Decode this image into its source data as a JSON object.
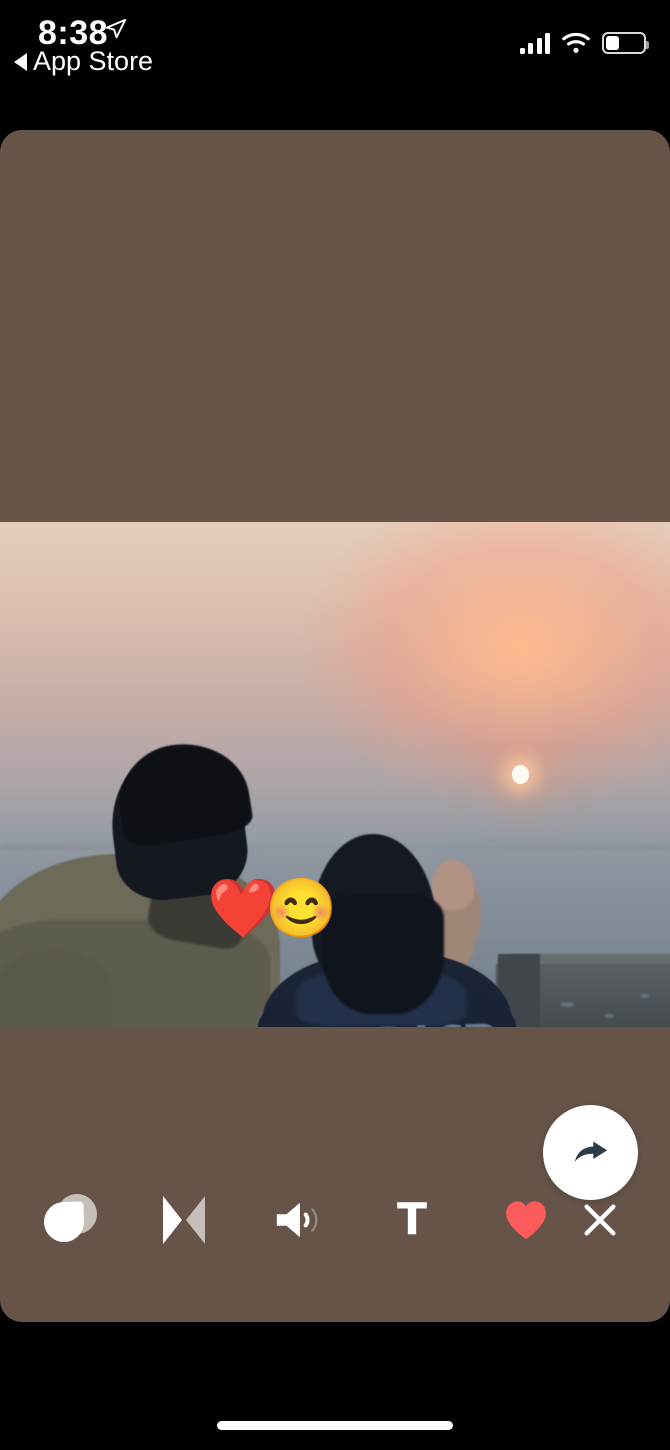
{
  "status_bar": {
    "time": "8:38",
    "location_icon": "location-arrow-icon",
    "back_label": "App Store",
    "back_caret_icon": "back-caret-icon",
    "signal_icon": "cellular-signal-icon",
    "signal_bars_filled": 3,
    "signal_bars_total": 4,
    "wifi_icon": "wifi-icon",
    "battery_icon": "battery-icon",
    "battery_level_percent": 30
  },
  "editor": {
    "canvas_background_color": "#665449",
    "photo": {
      "alt": "couple watching sunset from a hilltop",
      "hoodie_text": "JRGASR",
      "sun_label": "sun"
    },
    "stickers": [
      {
        "name": "heart-sticker",
        "glyph": "❤️"
      },
      {
        "name": "smiling-face-sticker",
        "glyph": "😊"
      }
    ],
    "share_button": {
      "label": "Share",
      "icon": "share-arrow-icon",
      "background_color": "#ffffff",
      "arrow_color": "#2d3b46"
    }
  },
  "toolbar": {
    "background_color": "#665449",
    "items": [
      {
        "name": "filter-tool",
        "label": "Filters",
        "icon": "filter-icon"
      },
      {
        "name": "mirror-tool",
        "label": "Mirror",
        "icon": "mirror-flip-icon"
      },
      {
        "name": "volume-tool",
        "label": "Volume",
        "icon": "speaker-icon"
      },
      {
        "name": "text-tool",
        "label": "Text",
        "icon": "text-icon",
        "glyph": "T"
      },
      {
        "name": "sticker-tool",
        "label": "Sticker",
        "icon": "heart-icon",
        "color": "#fc5b5b"
      },
      {
        "name": "close-tool",
        "label": "Close",
        "icon": "close-x-icon"
      }
    ]
  },
  "home_indicator": {
    "name": "home-indicator"
  }
}
